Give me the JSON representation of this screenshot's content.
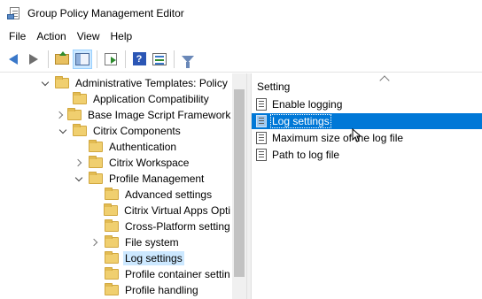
{
  "window": {
    "title": "Group Policy Management Editor"
  },
  "menu": {
    "items": [
      {
        "label": "File"
      },
      {
        "label": "Action"
      },
      {
        "label": "View"
      },
      {
        "label": "Help"
      }
    ]
  },
  "toolbar": {
    "buttons": [
      "back-icon",
      "forward-icon",
      "up-folder-icon",
      "show-hide-tree-icon",
      "export-list-icon",
      "help-icon",
      "properties-icon",
      "filter-icon"
    ]
  },
  "tree": {
    "nodes": [
      {
        "label": "Administrative Templates: Policy",
        "expand": "expanded",
        "depth": 0
      },
      {
        "label": "Application Compatibility",
        "expand": "none",
        "depth": 1
      },
      {
        "label": "Base Image Script Framework",
        "expand": "collapsed",
        "depth": 1
      },
      {
        "label": "Citrix Components",
        "expand": "expanded",
        "depth": 1
      },
      {
        "label": "Authentication",
        "expand": "none",
        "depth": 2
      },
      {
        "label": "Citrix Workspace",
        "expand": "collapsed",
        "depth": 2
      },
      {
        "label": "Profile Management",
        "expand": "expanded",
        "depth": 2
      },
      {
        "label": "Advanced settings",
        "expand": "none",
        "depth": 3
      },
      {
        "label": "Citrix Virtual Apps Opti",
        "expand": "none",
        "depth": 3
      },
      {
        "label": "Cross-Platform setting",
        "expand": "none",
        "depth": 3
      },
      {
        "label": "File system",
        "expand": "collapsed",
        "depth": 3
      },
      {
        "label": "Log settings",
        "expand": "none",
        "depth": 3,
        "selected": true
      },
      {
        "label": "Profile container settin",
        "expand": "none",
        "depth": 3
      },
      {
        "label": "Profile handling",
        "expand": "none",
        "depth": 3
      }
    ]
  },
  "settings": {
    "column_header": "Setting",
    "items": [
      {
        "label": "Enable logging"
      },
      {
        "label": "Log settings",
        "selected": true
      },
      {
        "label": "Maximum size of the log file"
      },
      {
        "label": "Path to log file"
      }
    ]
  }
}
